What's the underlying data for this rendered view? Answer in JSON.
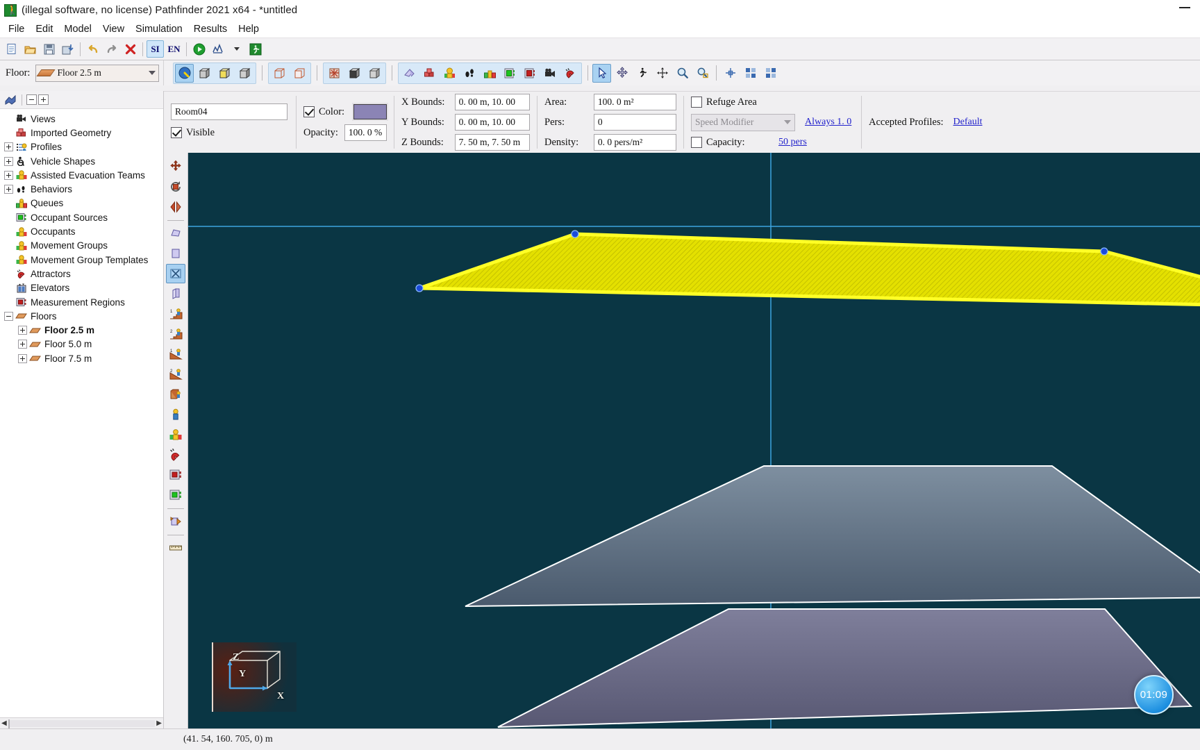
{
  "window": {
    "title": "(illegal software, no license) Pathfinder 2021 x64 - *untitled",
    "app_icon": "runner-icon",
    "minimize_label": "—"
  },
  "menubar": {
    "items": [
      "File",
      "Edit",
      "Model",
      "View",
      "Simulation",
      "Results",
      "Help"
    ]
  },
  "main_toolbar": {
    "buttons": [
      {
        "name": "new-file",
        "icon": "document-icon"
      },
      {
        "name": "open-file",
        "icon": "folder-open-icon"
      },
      {
        "name": "save-file",
        "icon": "floppy-disk-icon"
      },
      {
        "name": "import",
        "icon": "import-icon"
      },
      {
        "name": "undo",
        "icon": "undo-arrow-icon"
      },
      {
        "name": "redo",
        "icon": "redo-arrow-icon"
      },
      {
        "name": "delete",
        "icon": "red-x-icon"
      },
      {
        "name": "units-si",
        "icon": "text",
        "label": "SI"
      },
      {
        "name": "units-en",
        "icon": "text",
        "label": "EN"
      },
      {
        "name": "run-simulation",
        "icon": "green-play-icon"
      },
      {
        "name": "results-chart",
        "icon": "chart-icon"
      },
      {
        "name": "results-dropdown",
        "icon": "chevron-down-icon"
      },
      {
        "name": "viewer",
        "icon": "green-runner-icon"
      }
    ]
  },
  "floor_selector": {
    "label": "Floor:",
    "value": "Floor 2.5 m",
    "icon": "floor-plate-icon",
    "arrow": "chevron-down-icon"
  },
  "view_toolbar": {
    "groups": [
      [
        "navigate-view-icon",
        "box-white-icon",
        "box-yellow-icon",
        "box-grey-icon"
      ],
      [
        "wireframe-red-icon",
        "wireframe-pink-icon"
      ],
      [
        "texture-icon",
        "solid-box-icon",
        "shaded-box-icon"
      ],
      [
        "geometry-icon",
        "imported-geometry-icon",
        "occupant-icon",
        "behavior-icon",
        "queue-icon",
        "occupant-source-icon",
        "measurement-region-icon",
        "camera-icon",
        "attractor-icon"
      ],
      [
        "select-arrow-icon",
        "move-node-icon",
        "occupant-place-icon",
        "pan-icon",
        "zoom-icon",
        "zoom-window-icon"
      ],
      [
        "snap-icon",
        "grid-icon",
        "grid2-icon"
      ]
    ]
  },
  "properties": {
    "name": "Room04",
    "visible_label": "Visible",
    "visible_checked": true,
    "color_label": "Color:",
    "color_checked": true,
    "color_value": "#8b84b5",
    "opacity_label": "Opacity:",
    "opacity_value": "100. 0 %",
    "x_bounds_label": "X Bounds:",
    "x_bounds_value": "0. 00 m, 10. 00",
    "y_bounds_label": "Y Bounds:",
    "y_bounds_value": "0. 00 m, 10. 00",
    "z_bounds_label": "Z Bounds:",
    "z_bounds_value": "7. 50 m, 7. 50 m",
    "area_label": "Area:",
    "area_value": "100. 0 m²",
    "pers_label": "Pers:",
    "pers_value": "0",
    "density_label": "Density:",
    "density_value": "0. 0 pers/m²",
    "refuge_area_label": "Refuge Area",
    "refuge_area_checked": false,
    "speed_modifier_value": "Speed Modifier",
    "always_link": "Always 1. 0",
    "capacity_label": "Capacity:",
    "capacity_checked": false,
    "capacity_link": "50 pers",
    "accepted_profiles_label": "Accepted Profiles:",
    "accepted_profiles_value": "Default"
  },
  "tree": {
    "toolbar": {
      "collapse_all": "collapse-all-icon",
      "expand_all": "expand-all-icon",
      "root_icon": "model-icon"
    },
    "items": [
      {
        "label": "Views",
        "icon": "camera-icon",
        "expander": "none",
        "indent": 0,
        "bold": false
      },
      {
        "label": "Imported Geometry",
        "icon": "imported-geometry-icon",
        "expander": "none",
        "indent": 0,
        "bold": false
      },
      {
        "label": "Profiles",
        "icon": "profiles-icon",
        "expander": "plus",
        "indent": 0,
        "bold": false
      },
      {
        "label": "Vehicle Shapes",
        "icon": "wheelchair-icon",
        "expander": "plus",
        "indent": 0,
        "bold": false
      },
      {
        "label": "Assisted Evacuation Teams",
        "icon": "team-icon",
        "expander": "plus",
        "indent": 0,
        "bold": false
      },
      {
        "label": "Behaviors",
        "icon": "footprints-icon",
        "expander": "plus",
        "indent": 0,
        "bold": false
      },
      {
        "label": "Queues",
        "icon": "queue-icon",
        "expander": "none",
        "indent": 0,
        "bold": false
      },
      {
        "label": "Occupant Sources",
        "icon": "occupant-source-icon",
        "expander": "none",
        "indent": 0,
        "bold": false
      },
      {
        "label": "Occupants",
        "icon": "occupants-icon",
        "expander": "none",
        "indent": 0,
        "bold": false
      },
      {
        "label": "Movement Groups",
        "icon": "movement-group-icon",
        "expander": "none",
        "indent": 0,
        "bold": false
      },
      {
        "label": "Movement Group Templates",
        "icon": "movement-group-template-icon",
        "expander": "none",
        "indent": 0,
        "bold": false
      },
      {
        "label": "Attractors",
        "icon": "attractor-icon",
        "expander": "none",
        "indent": 0,
        "bold": false
      },
      {
        "label": "Elevators",
        "icon": "elevator-icon",
        "expander": "none",
        "indent": 0,
        "bold": false
      },
      {
        "label": "Measurement Regions",
        "icon": "measurement-region-icon",
        "expander": "none",
        "indent": 0,
        "bold": false
      },
      {
        "label": "Floors",
        "icon": "floor-plate-icon",
        "expander": "minus",
        "indent": 0,
        "bold": false
      },
      {
        "label": "Floor 2.5 m",
        "icon": "floor-plate-icon",
        "expander": "plus",
        "indent": 1,
        "bold": true
      },
      {
        "label": "Floor 5.0 m",
        "icon": "floor-plate-icon",
        "expander": "plus",
        "indent": 1,
        "bold": false
      },
      {
        "label": "Floor 7.5 m",
        "icon": "floor-plate-icon",
        "expander": "plus",
        "indent": 1,
        "bold": false
      }
    ]
  },
  "viewport": {
    "left_tools": [
      {
        "name": "move-tool",
        "icon": "move-arrows-icon"
      },
      {
        "name": "rotate-tool",
        "icon": "rotate-icon"
      },
      {
        "name": "mirror-tool",
        "icon": "mirror-icon"
      },
      {
        "name": "draw-room-tool",
        "icon": "room-polygon-icon"
      },
      {
        "name": "draw-rect-room-tool",
        "icon": "rect-room-icon"
      },
      {
        "name": "draw-door-tool",
        "icon": "door-icon",
        "active": true
      },
      {
        "name": "draw-wall-tool",
        "icon": "wall-icon"
      },
      {
        "name": "stair-up1-tool",
        "icon": "stair-1-icon"
      },
      {
        "name": "stair-up2-tool",
        "icon": "stair-2-icon"
      },
      {
        "name": "ramp-1-tool",
        "icon": "ramp-1-icon"
      },
      {
        "name": "ramp-2-tool",
        "icon": "ramp-2-icon"
      },
      {
        "name": "elevator-tool",
        "icon": "elevator-box-icon"
      },
      {
        "name": "occupant-tool",
        "icon": "single-occupant-icon"
      },
      {
        "name": "occupant-group-tool",
        "icon": "occupant-group-icon"
      },
      {
        "name": "attractor-tool",
        "icon": "attractor-magnet-icon"
      },
      {
        "name": "measurement-region-tool",
        "icon": "measurement-red-icon"
      },
      {
        "name": "occupant-source-tool",
        "icon": "source-green-icon"
      },
      {
        "name": "exit-tool",
        "icon": "exit-arrow-icon"
      },
      {
        "name": "measure-tool",
        "icon": "ruler-icon"
      }
    ],
    "axis_labels": {
      "x": "X",
      "y": "Y",
      "z": "Z"
    },
    "timer": "01:09",
    "selected_room_color": "#e8e400",
    "background_color": "#0a3644"
  },
  "statusbar": {
    "coordinates": "(41. 54,  160. 705,  0)  m"
  }
}
